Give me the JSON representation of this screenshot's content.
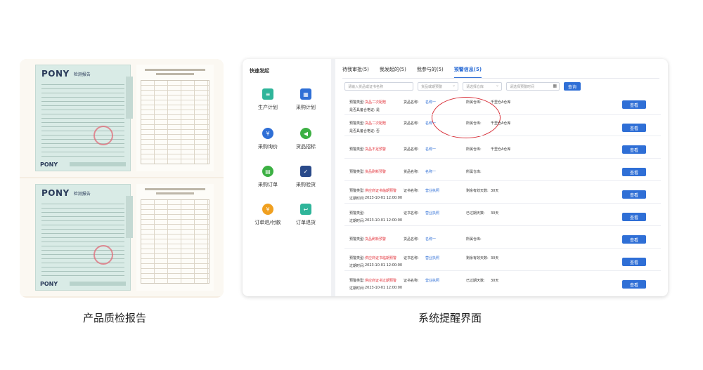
{
  "captions": {
    "left": "产品质检报告",
    "right": "系统提醒界面"
  },
  "report": {
    "logo": "PONY",
    "logo_sub": "检测报告"
  },
  "quick_launch": {
    "title": "快速发起",
    "items": [
      {
        "label": "生产计划",
        "icon": "clipboard-icon",
        "color": "#2fb59a"
      },
      {
        "label": "采购计划",
        "icon": "cart-icon",
        "color": "#2f6fd6"
      },
      {
        "label": "采购询价",
        "icon": "price-tag-icon",
        "color": "#2f6fd6"
      },
      {
        "label": "货品招标",
        "icon": "megaphone-icon",
        "color": "#3cb043"
      },
      {
        "label": "采购订单",
        "icon": "order-icon",
        "color": "#3cb043"
      },
      {
        "label": "采购验货",
        "icon": "shield-icon",
        "color": "#2a4a8a"
      },
      {
        "label": "订单退/付款",
        "icon": "yen-icon",
        "color": "#f0a020"
      },
      {
        "label": "订单退货",
        "icon": "return-icon",
        "color": "#2fb59a"
      }
    ]
  },
  "tabs": [
    {
      "label": "待我审批(5)",
      "active": false
    },
    {
      "label": "我发起的(5)",
      "active": false
    },
    {
      "label": "我参与的(5)",
      "active": false
    },
    {
      "label": "预警信息(5)",
      "active": true
    }
  ],
  "filters": {
    "search_placeholder": "请输入货品或证书名称",
    "type_placeholder": "货品或期预警",
    "warehouse_placeholder": "请选择仓库",
    "time_placeholder": "请选择预警时间",
    "query_label": "查询"
  },
  "view_label": "查看",
  "rows": [
    {
      "l1": "预警类型:",
      "v1": "货品二次配赔",
      "l2": "货品名称:",
      "v2": "名称一",
      "l3": "所属仓库:",
      "v3": "千里仓A仓库",
      "sub_l": "是否具备合格证:",
      "sub_v": "是"
    },
    {
      "l1": "预警类型:",
      "v1": "货品二次配赔",
      "l2": "货品名称:",
      "v2": "名称一",
      "l3": "所属仓库:",
      "v3": "千里仓A仓库",
      "sub_l": "是否具备合格证:",
      "sub_v": "否"
    },
    {
      "l1": "预警类型:",
      "v1": "货品不足预警",
      "l2": "货品名称:",
      "v2": "名称一",
      "l3": "所属仓库:",
      "v3": "千里仓A仓库",
      "sub_l": "",
      "sub_v": ""
    },
    {
      "l1": "预警类型:",
      "v1": "货品刷新预警",
      "l2": "货品名称:",
      "v2": "名称一",
      "l3": "所属仓库:",
      "v3": "",
      "sub_l": "",
      "sub_v": ""
    },
    {
      "l1": "预警类型:",
      "v1": "供应商证书临期预警",
      "l2": "证书名称:",
      "v2": "营业执照",
      "l3": "剩余有效天数:",
      "v3": "30天",
      "sub_l": "过期时间:",
      "sub_v": "2023-10-01 12:00:00"
    },
    {
      "l1": "预警类型:",
      "v1": "",
      "l2": "证书名称:",
      "v2": "营业执照",
      "l3": "已过期天数:",
      "v3": "30天",
      "sub_l": "过期时间:",
      "sub_v": "2023-10-01 12:00:00"
    },
    {
      "l1": "预警类型:",
      "v1": "货品刷新预警",
      "l2": "货品名称:",
      "v2": "名称一",
      "l3": "所属仓库:",
      "v3": "",
      "sub_l": "",
      "sub_v": ""
    },
    {
      "l1": "预警类型:",
      "v1": "供应商证书临期预警",
      "l2": "证书名称:",
      "v2": "营业执照",
      "l3": "剩余有效天数:",
      "v3": "30天",
      "sub_l": "过期时间:",
      "sub_v": "2023-10-01 12:00:00"
    },
    {
      "l1": "预警类型:",
      "v1": "供应商证书过期预警",
      "l2": "证书名称:",
      "v2": "营业执照",
      "l3": "已过期天数:",
      "v3": "30天",
      "sub_l": "过期时间:",
      "sub_v": "2023-10-01 12:00:00"
    }
  ]
}
